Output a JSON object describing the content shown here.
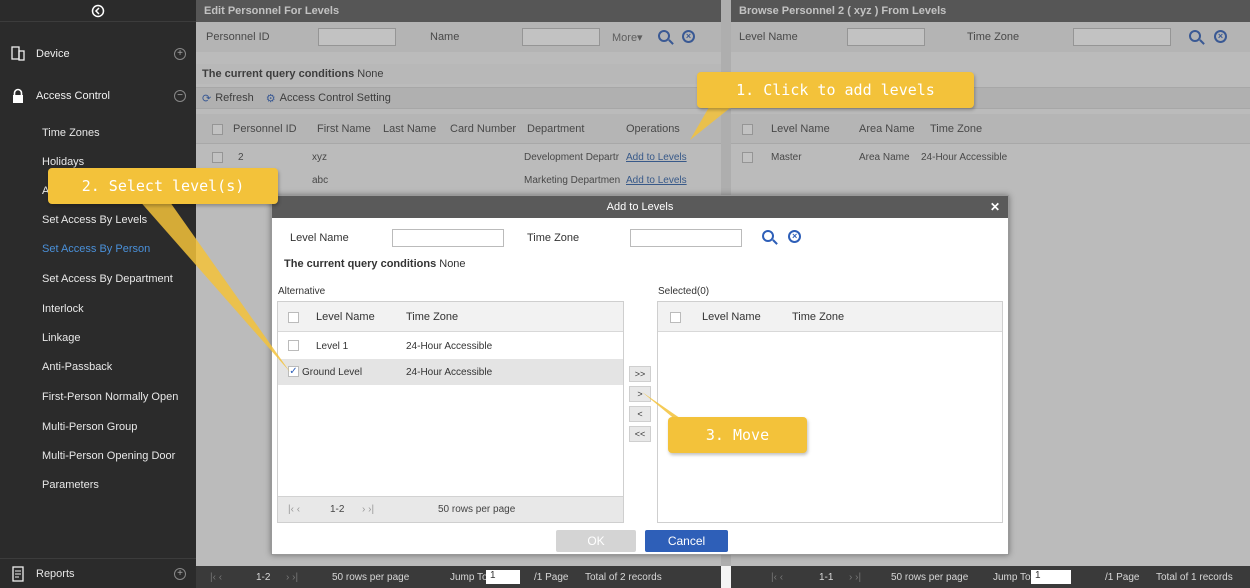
{
  "sidebar": {
    "collapse_icon": "collapse-circle-icon",
    "menus": [
      {
        "label": "Device",
        "icon": "device-icon",
        "toggle": "+"
      },
      {
        "label": "Access Control",
        "icon": "lock-icon",
        "toggle": "−"
      }
    ],
    "items": [
      {
        "label": "Time Zones"
      },
      {
        "label": "Holidays"
      },
      {
        "label": "Access Levels"
      },
      {
        "label": "Set Access By Levels"
      },
      {
        "label": "Set Access By Person",
        "active": true
      },
      {
        "label": "Set Access By Department"
      },
      {
        "label": "Interlock"
      },
      {
        "label": "Linkage"
      },
      {
        "label": "Anti-Passback"
      },
      {
        "label": "First-Person Normally Open"
      },
      {
        "label": "Multi-Person Group"
      },
      {
        "label": "Multi-Person Opening Door"
      },
      {
        "label": "Parameters"
      }
    ],
    "reports": {
      "label": "Reports",
      "toggle": "+"
    }
  },
  "left_panel": {
    "title": "Edit Personnel For Levels",
    "personnel_id_label": "Personnel ID",
    "name_label": "Name",
    "more_label": "More▾",
    "conditions_prefix": "The current query conditions",
    "conditions_value": "None",
    "refresh_label": "Refresh",
    "acs_label": "Access Control Setting",
    "columns": [
      "Personnel ID",
      "First Name",
      "Last Name",
      "Card Number",
      "Department",
      "Operations"
    ],
    "rows": [
      {
        "personnel_id": "2",
        "first_name": "xyz",
        "department": "Development Departr",
        "op": "Add to Levels"
      },
      {
        "personnel_id": "",
        "first_name": "abc",
        "department": "Marketing Departmen",
        "op": "Add to Levels"
      }
    ],
    "footer": {
      "range": "1-2",
      "rows_per_page": "50 rows per page",
      "jump_to": "Jump To",
      "page_value": "1",
      "pages": "/1 Page",
      "total": "Total of 2 records"
    }
  },
  "right_panel": {
    "title": "Browse Personnel 2 ( xyz ) From Levels",
    "level_name_label": "Level Name",
    "time_zone_label": "Time Zone",
    "columns": [
      "Level Name",
      "Area Name",
      "Time Zone"
    ],
    "rows": [
      {
        "level_name": "Master",
        "area_name": "Area Name",
        "time_zone": "24-Hour Accessible"
      }
    ],
    "footer": {
      "range": "1-1",
      "rows_per_page": "50 rows per page",
      "jump_to": "Jump To",
      "page_value": "1",
      "pages": "/1 Page",
      "total": "Total of 1 records"
    }
  },
  "dialog": {
    "title": "Add to Levels",
    "level_name_label": "Level Name",
    "time_zone_label": "Time Zone",
    "conditions_prefix": "The current query conditions",
    "conditions_value": "None",
    "alternative_label": "Alternative",
    "selected_label": "Selected(0)",
    "columns": [
      "Level Name",
      "Time Zone"
    ],
    "alt_rows": [
      {
        "level_name": "Level 1",
        "time_zone": "24-Hour Accessible",
        "checked": false
      },
      {
        "level_name": "Ground Level",
        "time_zone": "24-Hour Accessible",
        "checked": true
      }
    ],
    "move_buttons": [
      ">>",
      ">",
      "<",
      "<<"
    ],
    "pager": {
      "range": "1-2",
      "rows_per_page": "50 rows per page"
    },
    "ok_label": "OK",
    "cancel_label": "Cancel"
  },
  "callouts": {
    "step1": "1. Click to add levels",
    "step2": "2. Select level(s)",
    "step3": "3. Move"
  },
  "colors": {
    "accent": "#2e5fb8",
    "callout": "#f3c23a",
    "sidebar": "#2b2b2b",
    "active_item": "#4a90d9"
  }
}
